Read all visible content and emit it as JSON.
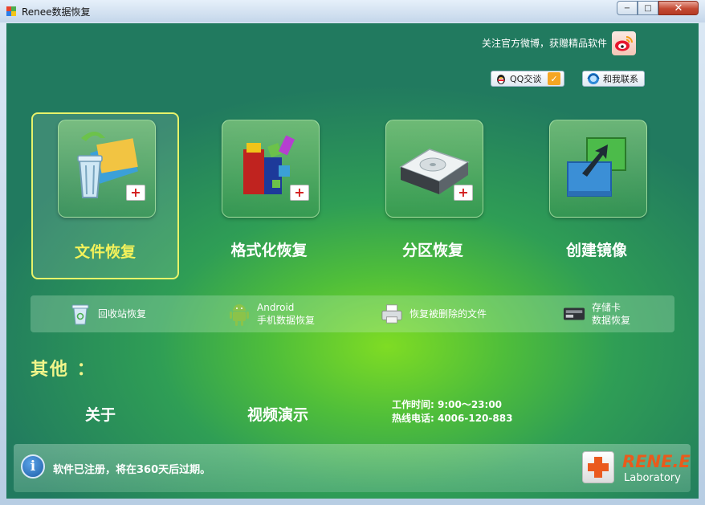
{
  "window": {
    "title": "Renee数据恢复",
    "controls": {
      "minimize": "−",
      "maximize": "□",
      "close": "✕"
    }
  },
  "header": {
    "weibo_text": "关注官方微博，获赠精品软件",
    "qq_label": "QQ交谈",
    "contact_label": "和我联系"
  },
  "features": [
    {
      "label": "文件恢复",
      "icon": "recycle-bin-folders-icon",
      "selected": true
    },
    {
      "label": "格式化恢复",
      "icon": "colored-blocks-icon",
      "selected": false
    },
    {
      "label": "分区恢复",
      "icon": "hard-drive-icon",
      "selected": false
    },
    {
      "label": "创建镜像",
      "icon": "disk-image-copy-icon",
      "selected": false
    }
  ],
  "quick": [
    {
      "label": "回收站恢复",
      "icon": "recycle-bin-icon"
    },
    {
      "label": "Android",
      "label2": "手机数据恢复",
      "icon": "android-icon"
    },
    {
      "label": "恢复被删除的文件",
      "icon": "printer-doc-icon"
    },
    {
      "label": "存储卡",
      "label2": "数据恢复",
      "icon": "card-reader-icon"
    }
  ],
  "others": {
    "title": "其他 ：",
    "about": "关于",
    "video": "视频演示",
    "hours": "工作时间: 9:00～23:00",
    "hotline": "热线电话: 4006-120-883"
  },
  "status": {
    "text": "软件已注册，将在360天后过期。",
    "logo_name": "RENE.E",
    "logo_sub": "Laboratory"
  },
  "colors": {
    "accent_selected": "#f4f25a",
    "background": "#2f9e55"
  }
}
